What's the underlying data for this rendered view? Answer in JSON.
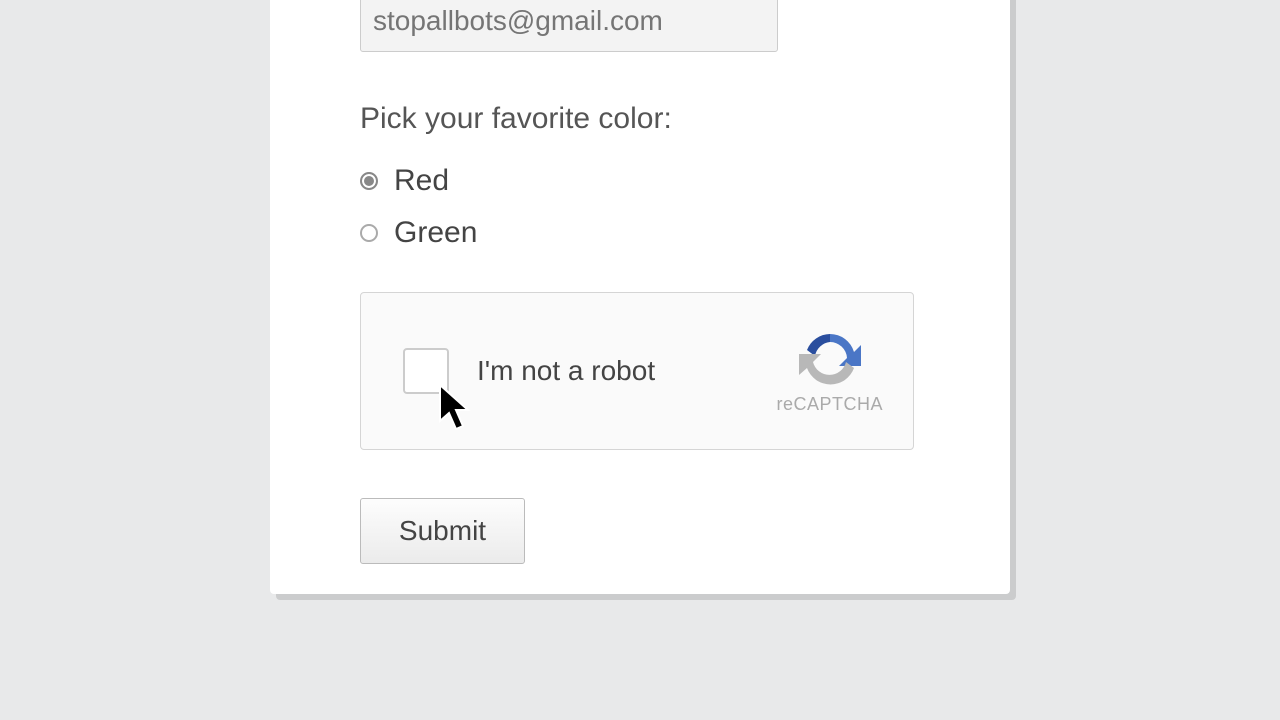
{
  "email": {
    "placeholder": "stopallbots@gmail.com"
  },
  "color_question": {
    "label": "Pick your favorite color:",
    "options": [
      {
        "label": "Red",
        "selected": true
      },
      {
        "label": "Green",
        "selected": false
      }
    ]
  },
  "recaptcha": {
    "text": "I'm not a robot",
    "brand": "reCAPTCHA"
  },
  "submit_label": "Submit"
}
